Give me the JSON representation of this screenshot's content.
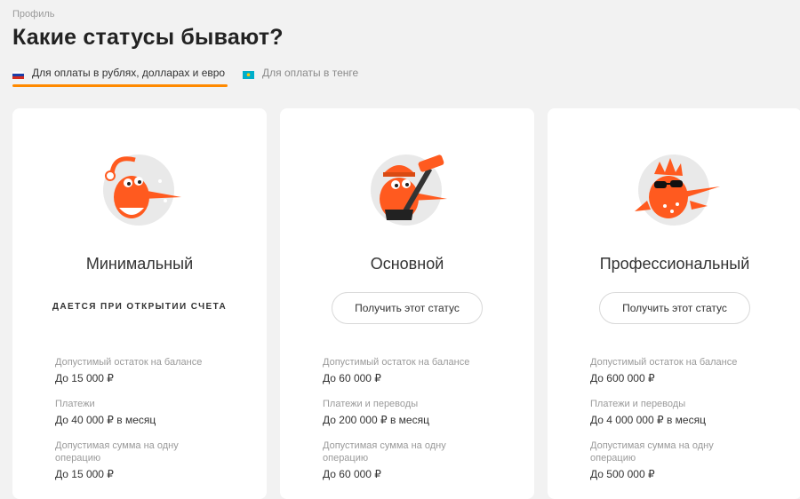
{
  "breadcrumb": "Профиль",
  "title": "Какие статусы бывают?",
  "tabs": [
    {
      "label": "Для оплаты в рублях, долларах и евро",
      "active": true,
      "flag": "russia-flag-icon"
    },
    {
      "label": "Для оплаты в тенге",
      "active": false,
      "flag": "kazakhstan-flag-icon"
    }
  ],
  "colors": {
    "accent": "#ff8a00",
    "mascot": "#ff5a1f",
    "background": "#f2f2f2"
  },
  "cards": [
    {
      "title": "Минимальный",
      "note": "ДАЕТСЯ ПРИ ОТКРЫТИИ СЧЕТА",
      "button": null,
      "mascot": "woodpecker-santa-hat-icon",
      "limits": [
        {
          "label": "Допустимый остаток на балансе",
          "value": "До 15 000 ₽"
        },
        {
          "label": "Платежи",
          "value": "До 40 000 ₽ в месяц"
        },
        {
          "label": "Допустимая сумма на одну операцию",
          "value": "До 15 000 ₽"
        }
      ]
    },
    {
      "title": "Основной",
      "note": null,
      "button": "Получить этот статус",
      "mascot": "woodpecker-hockey-icon",
      "limits": [
        {
          "label": "Допустимый остаток на балансе",
          "value": "До 60 000 ₽"
        },
        {
          "label": "Платежи и переводы",
          "value": "До 200 000 ₽ в месяц"
        },
        {
          "label": "Допустимая сумма на одну операцию",
          "value": "До 60 000 ₽"
        }
      ]
    },
    {
      "title": "Профессиональный",
      "note": null,
      "button": "Получить этот статус",
      "mascot": "woodpecker-sunglasses-icon",
      "limits": [
        {
          "label": "Допустимый остаток на балансе",
          "value": "До 600 000 ₽"
        },
        {
          "label": "Платежи и переводы",
          "value": "До 4 000 000 ₽ в месяц"
        },
        {
          "label": "Допустимая сумма на одну операцию",
          "value": "До 500 000 ₽"
        }
      ]
    }
  ]
}
